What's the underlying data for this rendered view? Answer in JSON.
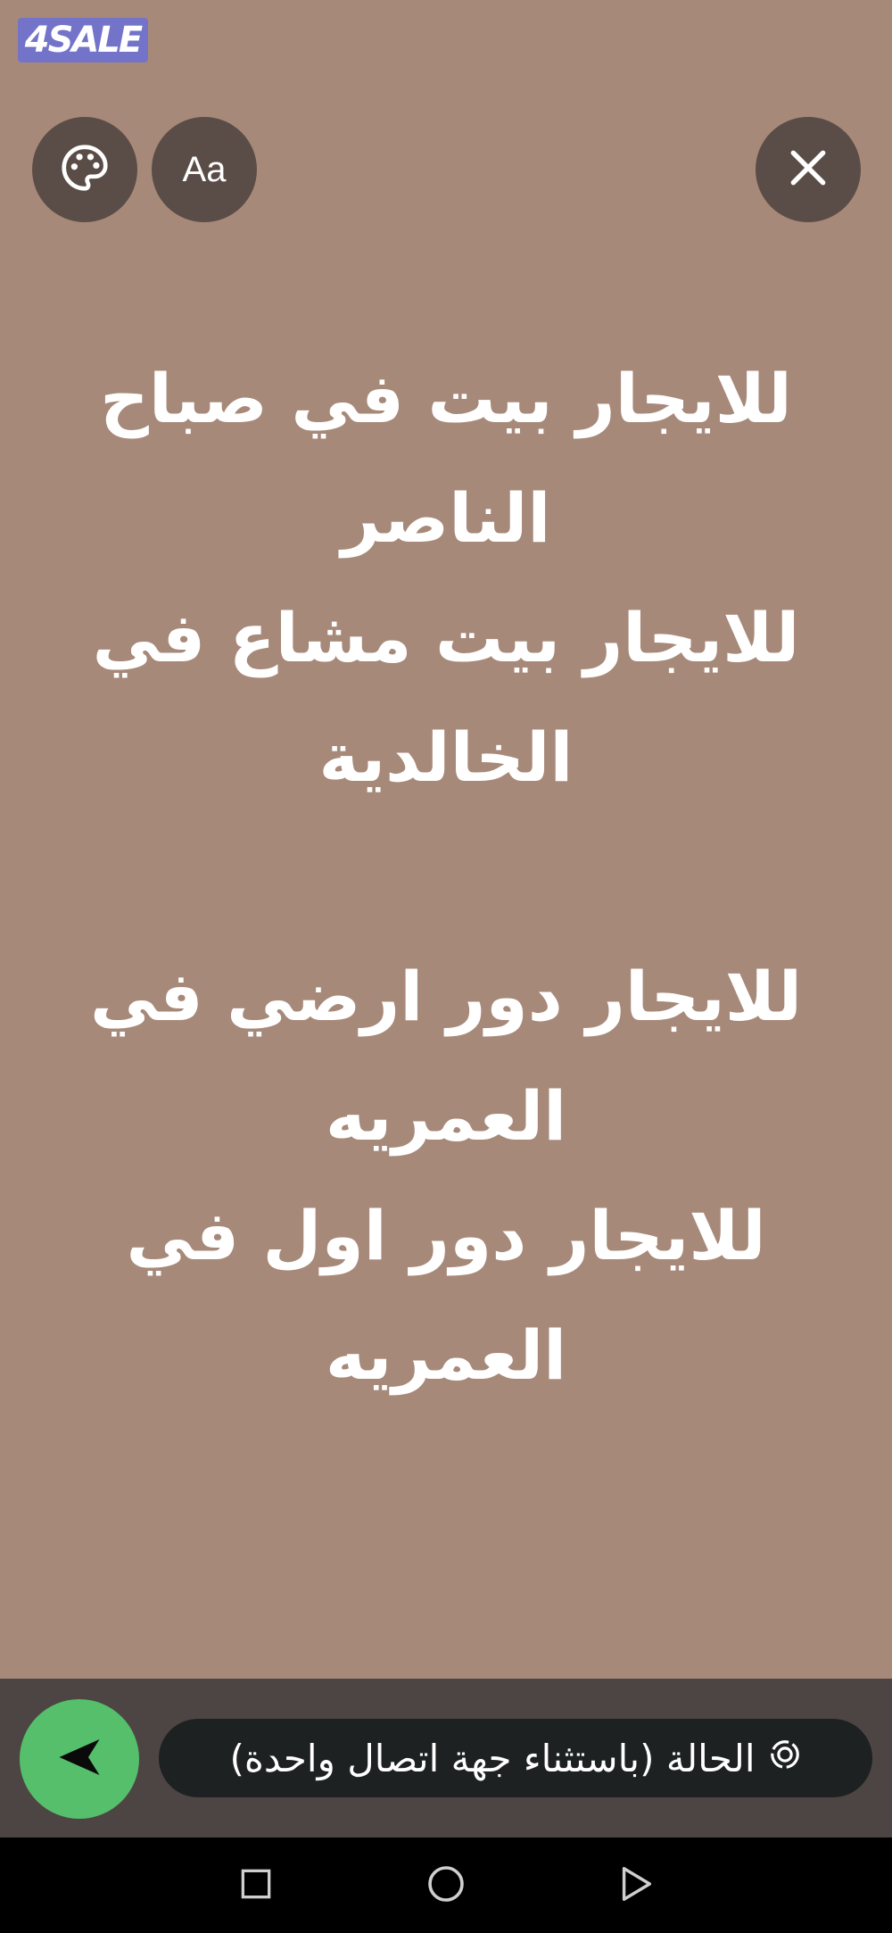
{
  "watermark": {
    "text": "4SALE"
  },
  "toolbar": {
    "font_button_label": "Aa",
    "icons": [
      "palette-icon",
      "close-icon"
    ]
  },
  "status": {
    "text": "للايجار بيت في صباح\nالناصر\nللايجار بيت مشاع في\nالخالدية\n\nللايجار دور ارضي في\nالعمريه\nللايجار دور اول  في\nالعمريه",
    "background_color": "#a78979",
    "text_color": "#ffffff"
  },
  "footer": {
    "audience_label": "الحالة (باستثناء جهة اتصال واحدة)",
    "send_icon": "send-icon",
    "audience_icon": "status-icon",
    "send_color": "#55bf6b"
  },
  "system_nav": {
    "icons": [
      "recents-icon",
      "home-icon",
      "back-icon"
    ]
  }
}
